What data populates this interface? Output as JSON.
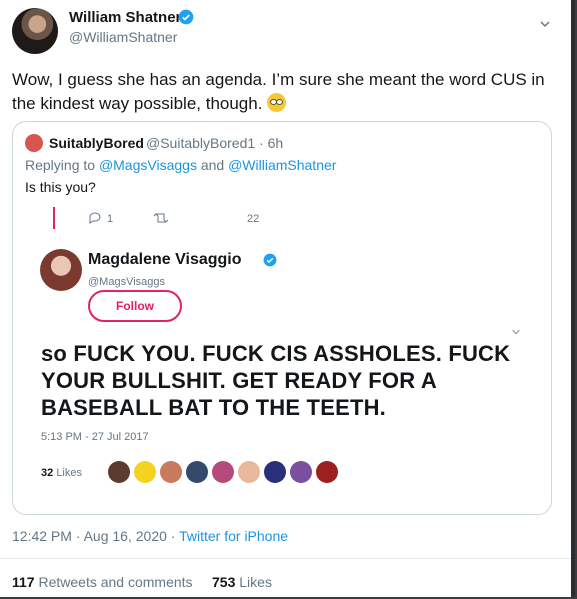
{
  "tweet": {
    "author_name": "William Shatner",
    "author_handle": "@WilliamShatner",
    "text": "Wow, I guess she has an agenda.  I’m sure she meant the word CUS in the kindest way possible, though.",
    "timestamp": "12:42 PM · Aug 16, 2020",
    "source": "Twitter for iPhone",
    "retweets_count": "117",
    "retweets_label": "Retweets and comments",
    "likes_count": "753",
    "likes_label": "Likes",
    "accent_color": "#1b95e0"
  },
  "quote": {
    "author_name": "SuitablyBored",
    "author_handle": "@SuitablyBored1 · 6h",
    "replying_prefix": "Replying to ",
    "replying_to_1": "@MagsVisaggs",
    "replying_and": " and ",
    "replying_to_2": "@WilliamShatner",
    "text": "Is this you?"
  },
  "embedded": {
    "reply_count": "1",
    "likes_stat": "22",
    "author_name": "Magdalene Visaggio",
    "author_handle": "@MagsVisaggs",
    "follow_label": "Follow",
    "text": "so FUCK YOU. FUCK CIS ASSHOLES. FUCK YOUR BULLSHIT. GET READY FOR A BASEBALL BAT TO THE TEETH.",
    "timestamp": "5:13 PM - 27 Jul 2017",
    "likes_count": "32",
    "likes_label": "Likes",
    "follow_color": "#e0245e"
  }
}
